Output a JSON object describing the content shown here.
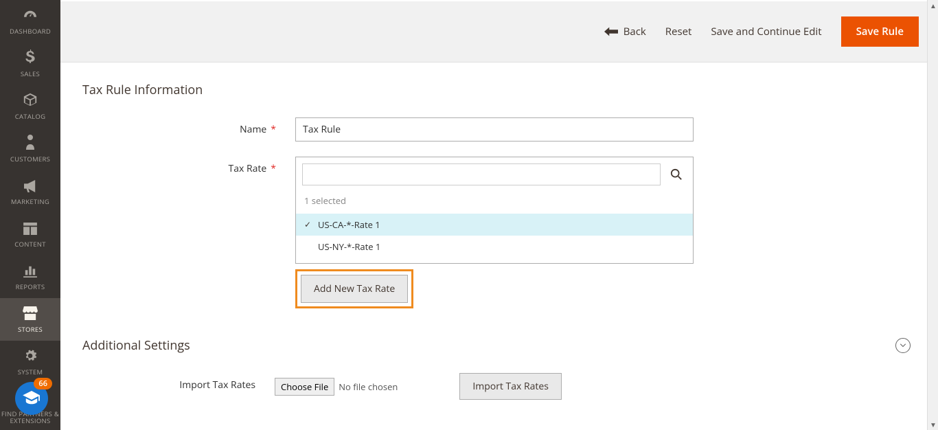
{
  "sidebar": {
    "items": [
      {
        "label": "DASHBOARD",
        "icon": "dashboard"
      },
      {
        "label": "SALES",
        "icon": "dollar"
      },
      {
        "label": "CATALOG",
        "icon": "cube"
      },
      {
        "label": "CUSTOMERS",
        "icon": "person"
      },
      {
        "label": "MARKETING",
        "icon": "megaphone"
      },
      {
        "label": "CONTENT",
        "icon": "layout"
      },
      {
        "label": "REPORTS",
        "icon": "chart"
      },
      {
        "label": "STORES",
        "icon": "store"
      },
      {
        "label": "SYSTEM",
        "icon": "gear"
      },
      {
        "label": "FIND PARTNERS & EXTENSIONS",
        "icon": "puzzle"
      }
    ],
    "active_index": 7,
    "badge_count": "66"
  },
  "actions": {
    "back": "Back",
    "reset": "Reset",
    "save_continue": "Save and Continue Edit",
    "save": "Save Rule"
  },
  "section": {
    "title": "Tax Rule Information",
    "name_label": "Name",
    "name_value": "Tax Rule",
    "taxrate_label": "Tax Rate",
    "selected_count": "1 selected",
    "rates": [
      {
        "label": "US-CA-*-Rate 1",
        "selected": true
      },
      {
        "label": "US-NY-*-Rate 1",
        "selected": false
      }
    ],
    "add_rate_btn": "Add New Tax Rate"
  },
  "additional": {
    "title": "Additional Settings",
    "import_label": "Import Tax Rates",
    "choose_file": "Choose File",
    "no_file": "No file chosen",
    "import_btn": "Import Tax Rates"
  }
}
